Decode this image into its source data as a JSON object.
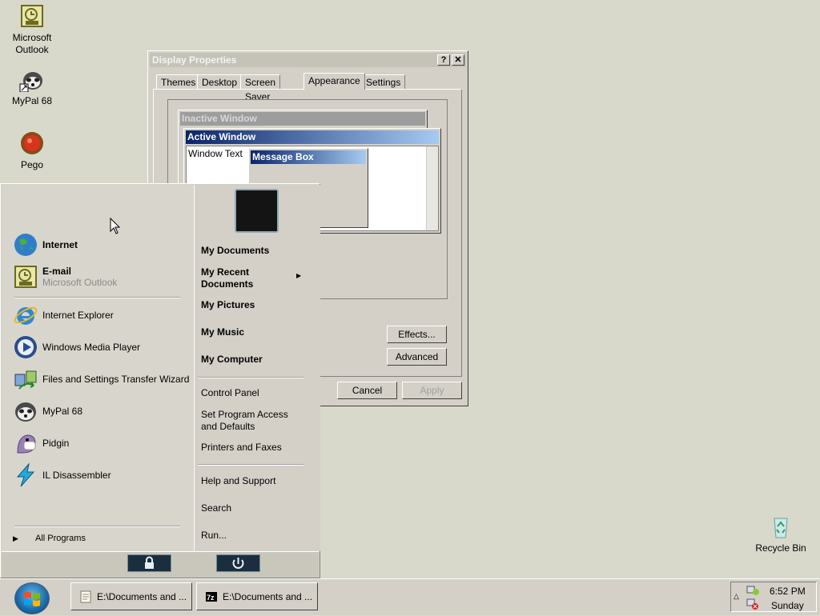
{
  "desktop": {
    "icons": [
      {
        "label_1": "Microsoft",
        "label_2": "Outlook"
      },
      {
        "label_1": "MyPal 68"
      },
      {
        "label_1": "Pego"
      },
      {
        "label_1": "Recycle Bin"
      }
    ]
  },
  "display_properties": {
    "title": "Display Properties",
    "title_buttons": {
      "help": "?",
      "close": "✕"
    },
    "tabs": [
      "Themes",
      "Desktop",
      "Screen Saver",
      "Appearance",
      "Settings"
    ],
    "active_tab": "Appearance",
    "preview": {
      "inactive_title": "Inactive Window",
      "active_title": "Active Window",
      "window_text": "Window Text",
      "message_box_title": "Message Box"
    },
    "buttons": {
      "effects": "Effects...",
      "advanced": "Advanced",
      "cancel": "Cancel",
      "apply": "Apply"
    }
  },
  "start_menu": {
    "pinned": [
      {
        "title": "Internet"
      },
      {
        "title": "E-mail",
        "subtitle": "Microsoft Outlook"
      }
    ],
    "recent": [
      "Internet Explorer",
      "Windows Media Player",
      "Files and Settings Transfer Wizard",
      "MyPal 68",
      "Pidgin",
      "IL Disassembler"
    ],
    "all_programs": "All Programs",
    "right_primary": [
      "My Documents",
      "My Recent Documents",
      "My Pictures",
      "My Music",
      "My Computer"
    ],
    "right_secondary": [
      "Control Panel",
      "Set Program Access and Defaults",
      "Printers and Faxes"
    ],
    "right_tertiary": [
      "Help and Support",
      "Search",
      "Run..."
    ]
  },
  "taskbar": {
    "tasks": [
      "E:\\Documents and ...",
      "E:\\Documents and ..."
    ],
    "clock_time": "6:52 PM",
    "clock_day": "Sunday"
  },
  "colors": {
    "desktop": "#d8d9ca",
    "active_title": "#0a246a",
    "inactive_title": "#808080"
  }
}
